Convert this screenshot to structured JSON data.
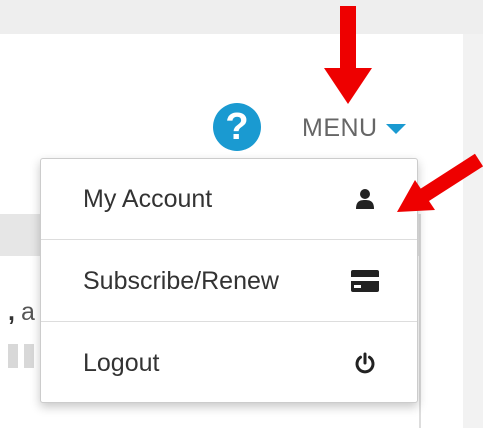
{
  "header": {
    "help_icon": "question-mark-circle",
    "help_symbol": "?",
    "menu_label": "MENU",
    "caret_icon": "caret-down"
  },
  "dropdown": {
    "items": [
      {
        "label": "My Account",
        "icon": "user-icon"
      },
      {
        "label": "Subscribe/Renew",
        "icon": "credit-card-icon"
      },
      {
        "label": "Logout",
        "icon": "power-icon"
      }
    ]
  },
  "background": {
    "partial_text": "a"
  },
  "colors": {
    "accent_blue": "#1a9ad1",
    "annotation_red": "#ee0000",
    "menu_text": "#666666",
    "item_text": "#333333"
  }
}
